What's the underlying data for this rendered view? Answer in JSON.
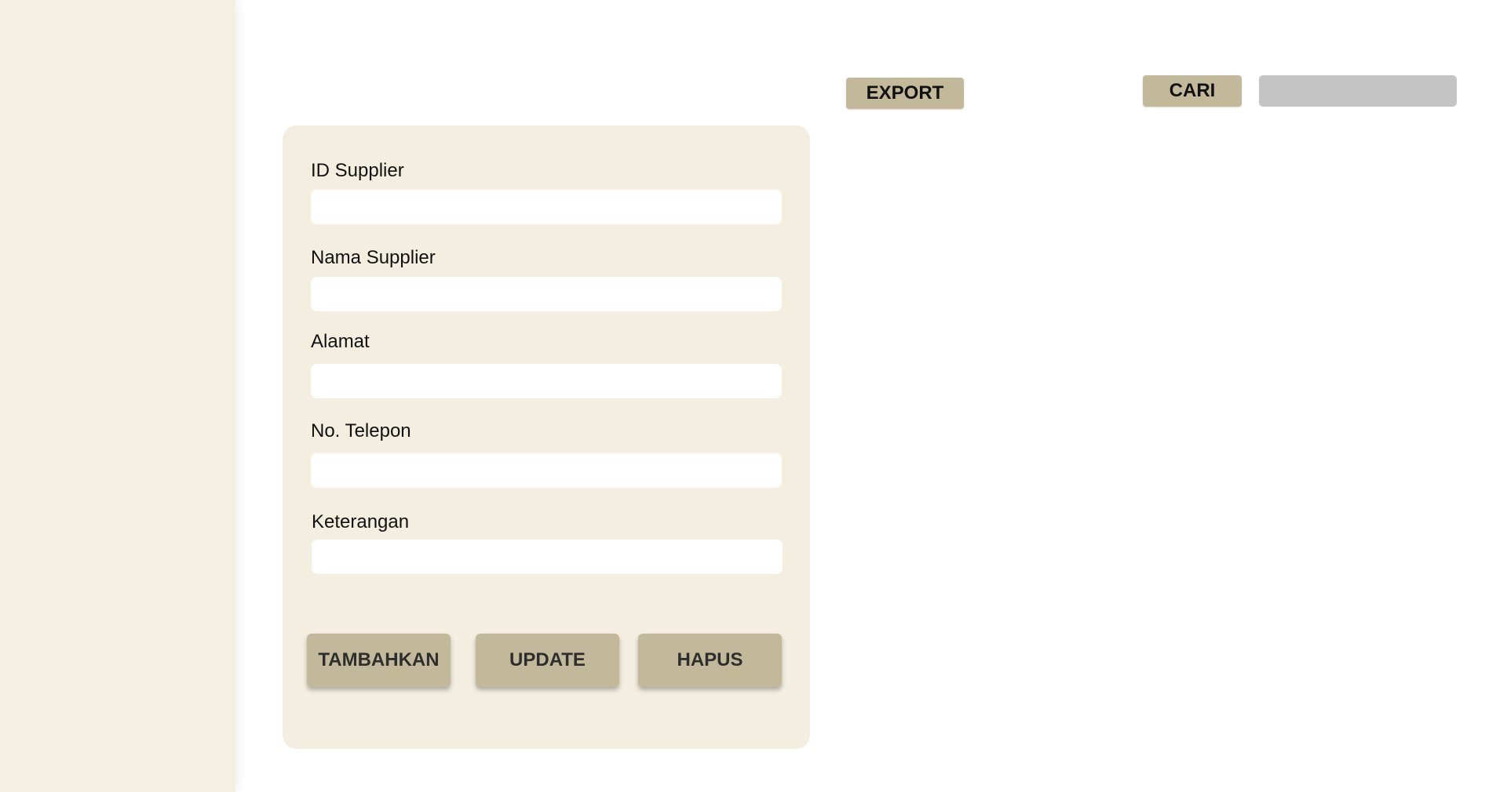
{
  "toolbar": {
    "export_label": "EXPORT",
    "search_button_label": "CARI",
    "search_value": "",
    "search_placeholder": ""
  },
  "form": {
    "fields": [
      {
        "label": "ID Supplier",
        "value": "",
        "placeholder": ""
      },
      {
        "label": "Nama Supplier",
        "value": "",
        "placeholder": ""
      },
      {
        "label": "Alamat",
        "value": "",
        "placeholder": ""
      },
      {
        "label": "No. Telepon",
        "value": "",
        "placeholder": ""
      },
      {
        "label": "Keterangan",
        "value": "",
        "placeholder": ""
      }
    ],
    "buttons": {
      "add_label": "TAMBAHKAN",
      "update_label": "UPDATE",
      "delete_label": "HAPUS"
    }
  },
  "colors": {
    "sidebar_bg": "#f5efe1",
    "panel_bg": "#f4eee0",
    "button_bg": "#c2b99b",
    "search_bg": "#c4c4c4"
  }
}
